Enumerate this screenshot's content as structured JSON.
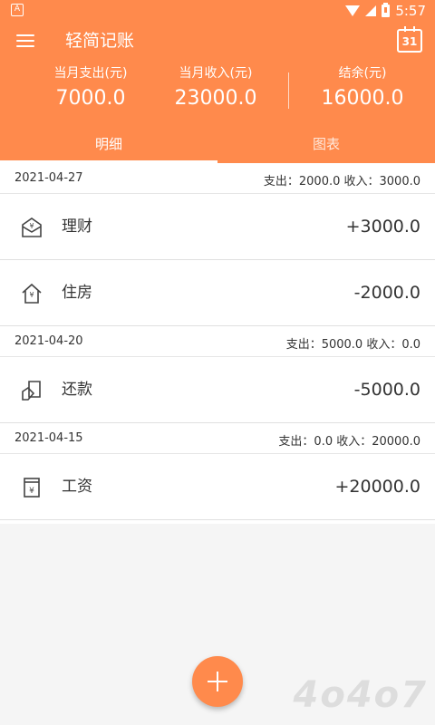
{
  "status_bar": {
    "time": "5:57",
    "notif_icon": "app-notification-icon"
  },
  "app_bar": {
    "title": "轻简记账",
    "calendar_day": "31"
  },
  "summary": {
    "expense_label": "当月支出(元)",
    "expense_value": "7000.0",
    "income_label": "当月收入(元)",
    "income_value": "23000.0",
    "balance_label": "结余(元)",
    "balance_value": "16000.0"
  },
  "tabs": [
    {
      "label": "明细",
      "selected": true
    },
    {
      "label": "图表",
      "selected": false
    }
  ],
  "groups": [
    {
      "date": "2021-04-27",
      "summary": "支出：2000.0 收入：3000.0",
      "entries": [
        {
          "icon": "investment-icon",
          "name": "理财",
          "amount": "+3000.0"
        },
        {
          "icon": "housing-icon",
          "name": "住房",
          "amount": "-2000.0"
        }
      ]
    },
    {
      "date": "2021-04-20",
      "summary": "支出：5000.0 收入：0.0",
      "entries": [
        {
          "icon": "repayment-icon",
          "name": "还款",
          "amount": "-5000.0"
        }
      ]
    },
    {
      "date": "2021-04-15",
      "summary": "支出：0.0 收入：20000.0",
      "entries": [
        {
          "icon": "salary-icon",
          "name": "工资",
          "amount": "+20000.0"
        }
      ]
    }
  ],
  "colors": {
    "accent": "#ff8a4c",
    "background": "#f5f5f5"
  },
  "watermark": "4o4o7"
}
